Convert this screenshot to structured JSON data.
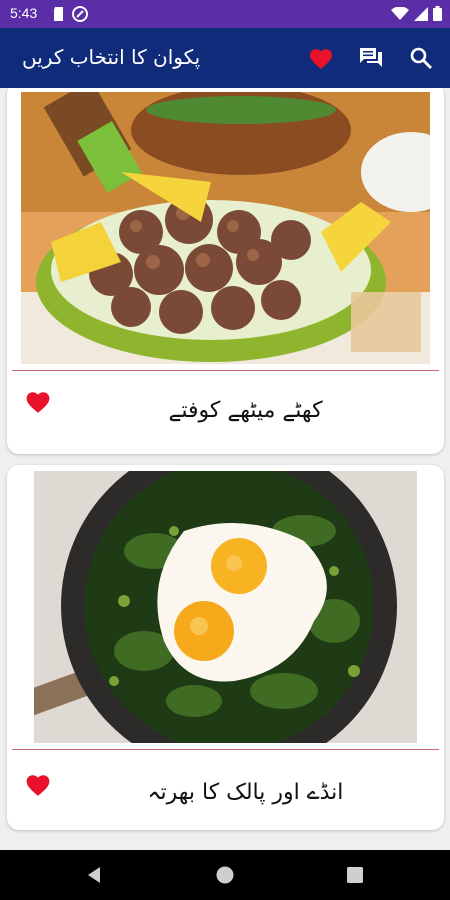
{
  "status_bar": {
    "time": "5:43",
    "icons": [
      "sd-card-icon",
      "no-disturb-icon",
      "wifi-icon",
      "signal-icon",
      "battery-icon"
    ]
  },
  "app_bar": {
    "title": "پکوان کا انتخاب کریں",
    "actions": [
      "favorites-heart-icon",
      "chat-icon",
      "search-icon"
    ]
  },
  "recipes": [
    {
      "title": "کھٹے میٹھے کوفتے",
      "favorite": true
    },
    {
      "title": "انڈے اور پالک کا بھرتہ",
      "favorite": true
    }
  ],
  "colors": {
    "status_bar": "#5a2ea6",
    "app_bar": "#0f2b7a",
    "heart": "#e8122b",
    "divider": "#c96a74"
  },
  "nav_bar": {
    "buttons": [
      "back-icon",
      "home-icon",
      "recents-icon"
    ]
  }
}
